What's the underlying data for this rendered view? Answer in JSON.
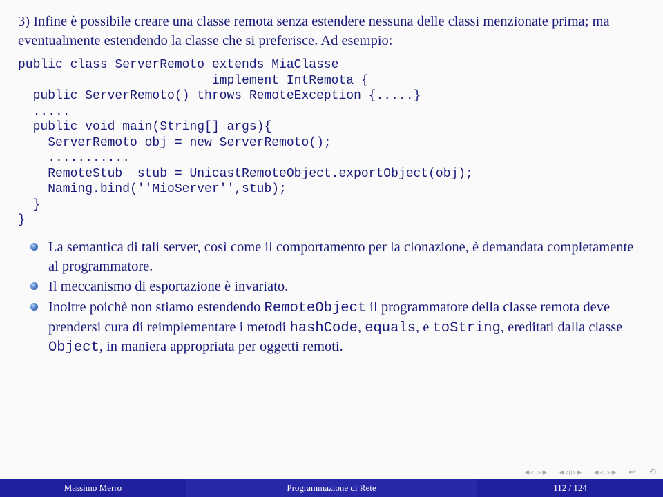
{
  "intro": "3) Infine è possibile creare una classe remota senza estendere nessuna delle classi menzionate prima; ma eventualmente estendendo la classe che si preferisce. Ad esempio:",
  "code": "public class ServerRemoto extends MiaClasse\n                          implement IntRemota {\n  public ServerRemoto() throws RemoteException {.....}\n  .....\n  public void main(String[] args){\n    ServerRemoto obj = new ServerRemoto();\n    ...........\n    RemoteStub  stub = UnicastRemoteObject.exportObject(obj);\n    Naming.bind(''MioServer'',stub);\n  }\n}",
  "bullets": [
    {
      "segments": [
        {
          "t": "La semantica di tali server, così come il comportamento per la clonazione, è demandata completamente al programmatore.",
          "tt": false
        }
      ]
    },
    {
      "segments": [
        {
          "t": "Il meccanismo di esportazione è invariato.",
          "tt": false
        }
      ]
    },
    {
      "segments": [
        {
          "t": "Inoltre poichè non stiamo estendendo ",
          "tt": false
        },
        {
          "t": "RemoteObject",
          "tt": true
        },
        {
          "t": " il programmatore della classe remota deve prendersi cura di reimplementare i metodi ",
          "tt": false
        },
        {
          "t": "hashCode",
          "tt": true
        },
        {
          "t": ", ",
          "tt": false
        },
        {
          "t": "equals",
          "tt": true
        },
        {
          "t": ", e ",
          "tt": false
        },
        {
          "t": "toString",
          "tt": true
        },
        {
          "t": ", ereditati dalla classe ",
          "tt": false
        },
        {
          "t": "Object",
          "tt": true
        },
        {
          "t": ", in maniera appropriata per oggetti remoti.",
          "tt": false
        }
      ]
    }
  ],
  "footer": {
    "author": "Massimo Merro",
    "title": "Programmazione di Rete",
    "page": "112 / 124"
  },
  "nav": {
    "first": "◂",
    "prev": "◃",
    "next": "▹",
    "last": "▸",
    "back": "↩",
    "cycle": "⟲"
  }
}
